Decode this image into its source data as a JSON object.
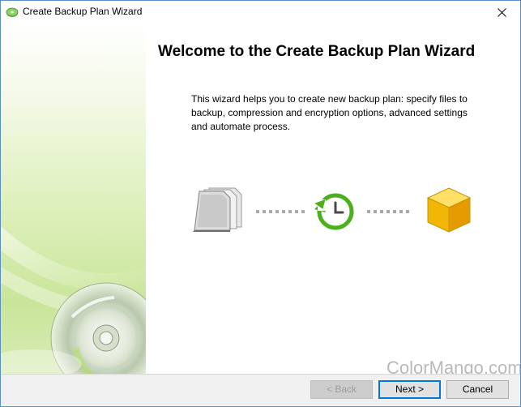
{
  "window": {
    "title": "Create Backup Plan Wizard",
    "icon": "cd-backup-icon"
  },
  "content": {
    "heading": "Welcome to the Create Backup Plan Wizard",
    "description": "This wizard helps you to create new backup plan: specify files to backup, compression and encryption options, advanced settings and automate process."
  },
  "flow": {
    "icons": [
      "documents-icon",
      "clock-arrow-icon",
      "box-icon"
    ]
  },
  "buttons": {
    "back": "< Back",
    "next": "Next >",
    "cancel": "Cancel"
  },
  "watermark": "ColorMango.com",
  "colors": {
    "accent": "#0078d7",
    "green": "#4caf1c",
    "box": "#f2b705"
  }
}
